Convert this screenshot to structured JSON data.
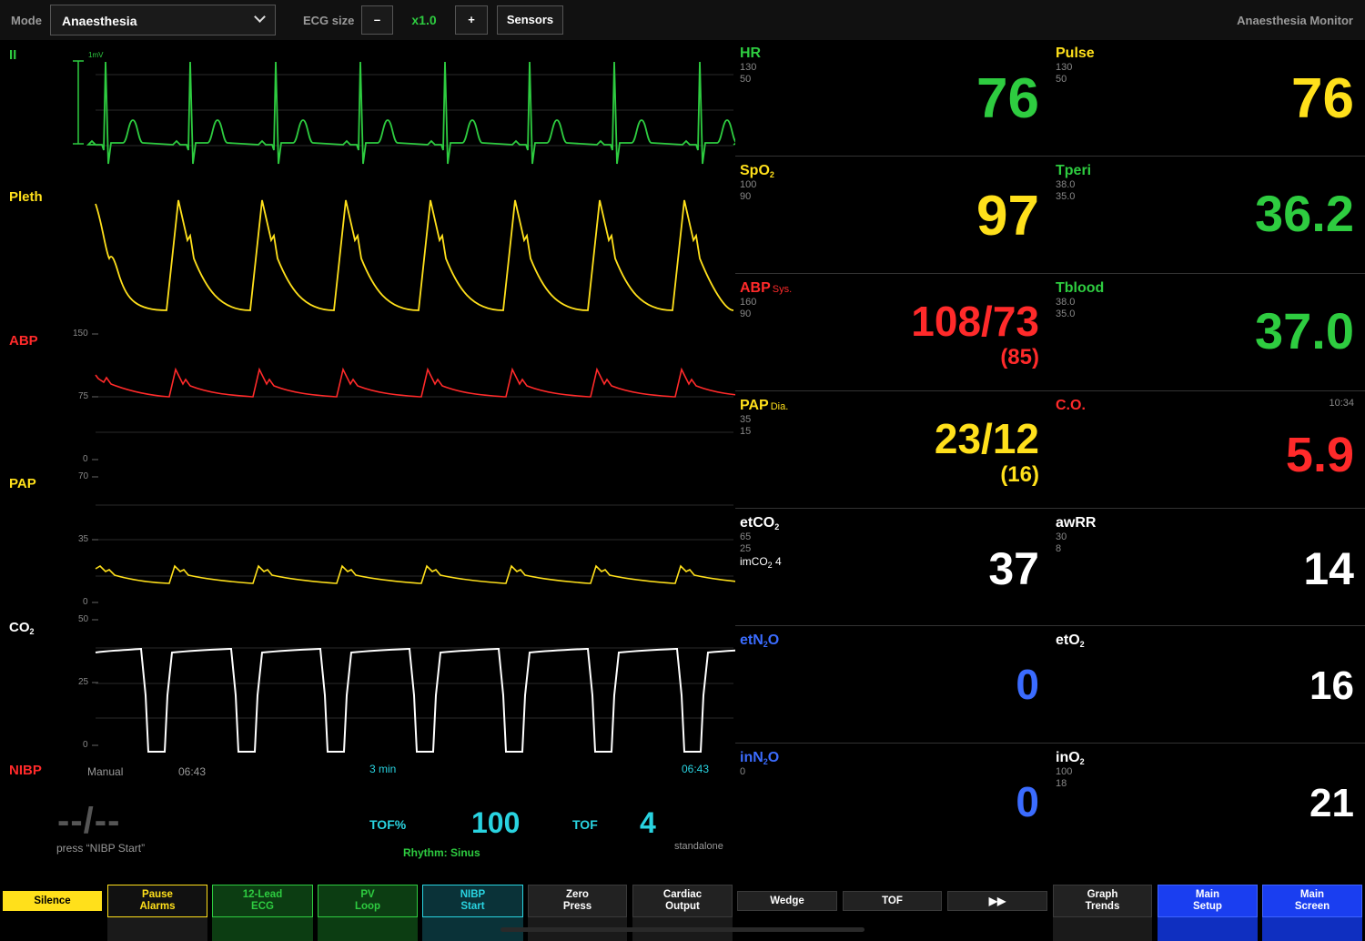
{
  "topbar": {
    "mode_label": "Mode",
    "mode_value": "Anaesthesia",
    "ecg_size_label": "ECG size",
    "minus_label": "–",
    "ecg_size_value": "x1.0",
    "plus_label": "+",
    "sensors_label": "Sensors",
    "app_title": "Anaesthesia  Monitor"
  },
  "waveforms": {
    "ecg": {
      "label": "II",
      "scale": "1mV",
      "color": "#2ecc40"
    },
    "pleth": {
      "label": "Pleth",
      "color": "#ffe01b"
    },
    "abp": {
      "label": "ABP",
      "ticks": [
        "150",
        "75",
        "0"
      ],
      "color": "#ff2a2a"
    },
    "pap": {
      "label": "PAP",
      "ticks": [
        "70",
        "35",
        "0"
      ],
      "color": "#ffe01b"
    },
    "co2": {
      "label": "CO",
      "label_sub": "2",
      "ticks": [
        "50",
        "25",
        "0"
      ],
      "color": "#ffffff"
    }
  },
  "nibp": {
    "label": "NIBP",
    "mode": "Manual",
    "time": "06:43",
    "interval": "3 min",
    "time2": "06:43",
    "value": "--/--",
    "hint": "press  “NIBP Start”",
    "standalone": "standalone"
  },
  "tof": {
    "tof_pct_label": "TOF%",
    "tof_pct_value": "100",
    "tof_label": "TOF",
    "tof_value": "4",
    "rhythm": "Rhythm: Sinus"
  },
  "tiles": {
    "hr": {
      "label": "HR",
      "hi": "130",
      "lo": "50",
      "value": "76",
      "color": "#2ecc40"
    },
    "pulse": {
      "label": "Pulse",
      "hi": "130",
      "lo": "50",
      "value": "76",
      "color": "#ffe01b"
    },
    "spo2": {
      "label": "SpO",
      "label_sub": "2",
      "hi": "100",
      "lo": "90",
      "value": "97",
      "color": "#ffe01b"
    },
    "tperi": {
      "label": "Tperi",
      "hi": "38.0",
      "lo": "35.0",
      "value": "36.2",
      "color": "#2ecc40"
    },
    "abp": {
      "label": "ABP",
      "sub": "Sys.",
      "hi": "160",
      "lo": "90",
      "value": "108/73",
      "mean": "(85)",
      "color": "#ff2a2a"
    },
    "tblood": {
      "label": "Tblood",
      "hi": "38.0",
      "lo": "35.0",
      "value": "37.0",
      "color": "#2ecc40"
    },
    "pap": {
      "label": "PAP",
      "sub": "Dia.",
      "hi": "35",
      "lo": "15",
      "value": "23/12",
      "mean": "(16)",
      "color": "#ffe01b"
    },
    "co": {
      "label": "C.O.",
      "time": "10:34",
      "value": "5.9",
      "color": "#ff2a2a"
    },
    "etco2": {
      "label": "etCO",
      "label_sub": "2",
      "hi": "65",
      "lo": "25",
      "extra": "imCO",
      "extra_sub": "2",
      "extra_val": "4",
      "value": "37",
      "color": "#ffffff"
    },
    "awrr": {
      "label": "awRR",
      "hi": "30",
      "lo": "8",
      "value": "14",
      "color": "#ffffff"
    },
    "etn2o": {
      "label": "etN",
      "label_sub": "2",
      "label_tail": "O",
      "value": "0",
      "color": "#3b6cff"
    },
    "eto2": {
      "label": "etO",
      "label_sub": "2",
      "value": "16",
      "color": "#ffffff"
    },
    "inn2o": {
      "label": "inN",
      "label_sub": "2",
      "label_tail": "O",
      "lo": "0",
      "value": "0",
      "color": "#3b6cff"
    },
    "ino2": {
      "label": "inO",
      "label_sub": "2",
      "hi": "100",
      "lo": "18",
      "value": "21",
      "color": "#ffffff"
    }
  },
  "buttons": {
    "silence": "Silence",
    "pause_alarms": "Pause\nAlarms",
    "lead12": "12-Lead\nECG",
    "pv_loop": "PV\nLoop",
    "nibp_start": "NIBP\nStart",
    "zero_press": "Zero\nPress",
    "cardiac_output": "Cardiac\nOutput",
    "wedge": "Wedge",
    "tof": "TOF",
    "forward": "▶▶",
    "graph_trends": "Graph\nTrends",
    "main_setup": "Main\nSetup",
    "main_screen": "Main\nScreen"
  }
}
